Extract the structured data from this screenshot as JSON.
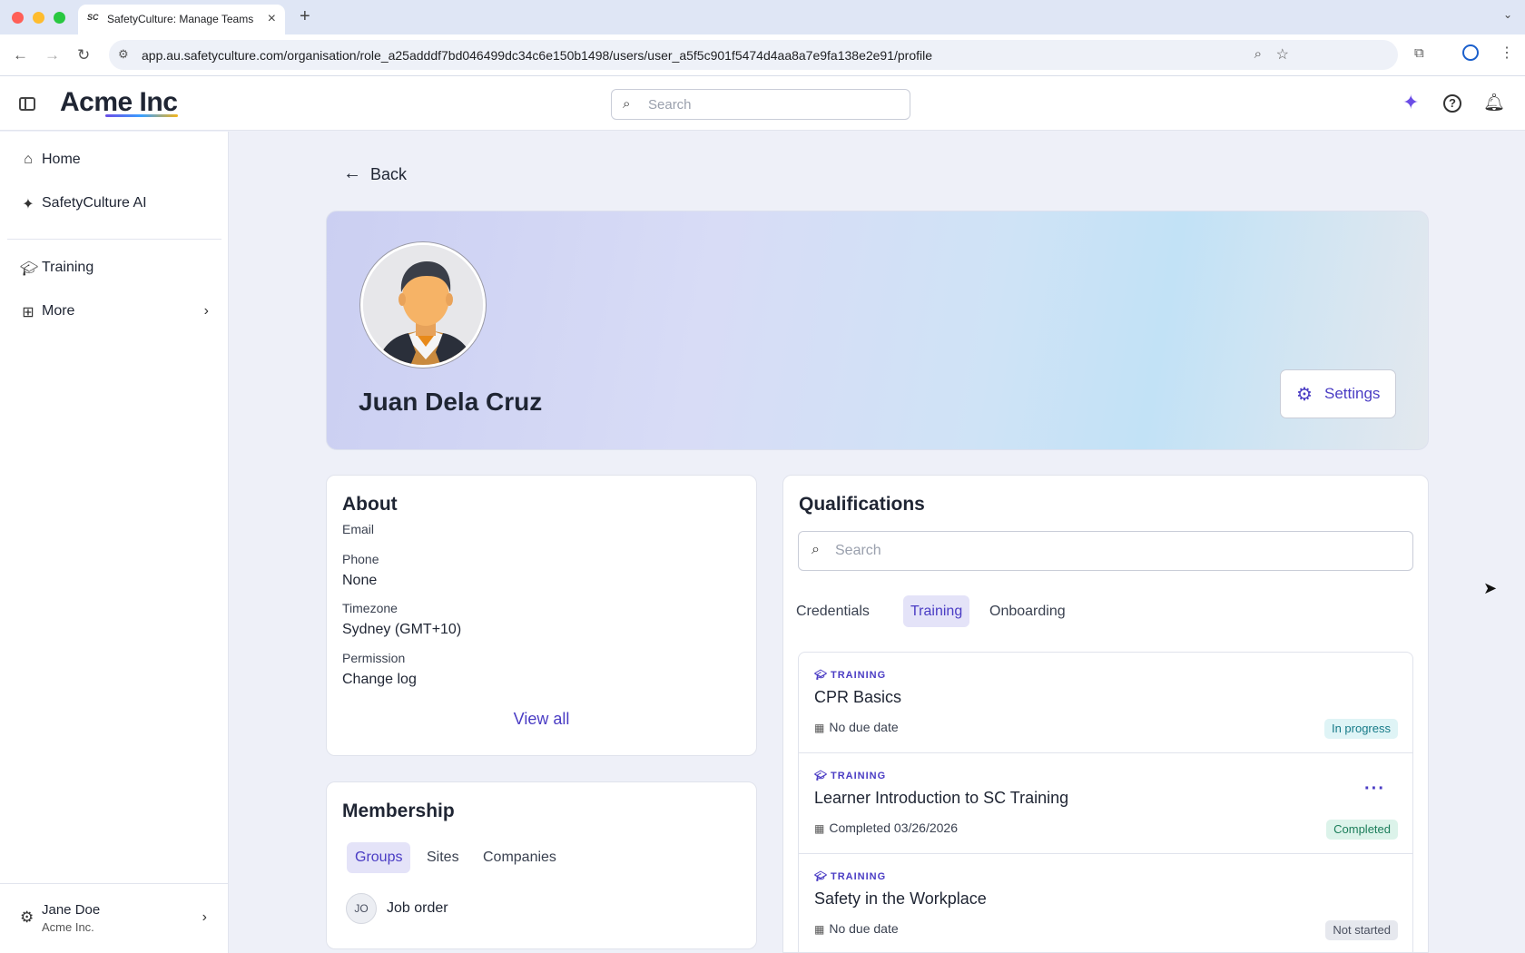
{
  "browser": {
    "tab_title": "SafetyCulture: Manage Teams",
    "favicon_text": "SC",
    "url": "app.au.safetyculture.com/organisation/role_a25adddf7bd046499dc34c6e150b1498/users/user_a5f5c901f5474d4aa8a7e9fa138e2e91/profile"
  },
  "header": {
    "logo": "Acme Inc",
    "search_placeholder": "Search",
    "icons": [
      "sidebar-toggle-icon",
      "sparkle-icon",
      "help-icon",
      "bell-icon"
    ]
  },
  "sidebar": {
    "items": [
      {
        "label": "Home",
        "icon": "home-icon"
      },
      {
        "label": "SafetyCulture AI",
        "icon": "sparkle-icon"
      },
      {
        "label": "Training",
        "icon": "graduation-cap-icon"
      },
      {
        "label": "More",
        "icon": "grid-icon"
      }
    ],
    "user": {
      "name": "Jane Doe",
      "org": "Acme Inc."
    }
  },
  "main": {
    "back_label": "Back",
    "profile": {
      "name": "Juan Dela Cruz",
      "settings_label": "Settings"
    },
    "about": {
      "title": "About",
      "fields": [
        {
          "label": "Email",
          "value": ""
        },
        {
          "label": "Phone",
          "value": "None"
        },
        {
          "label": "Timezone",
          "value": "Sydney (GMT+10)"
        },
        {
          "label": "Permission",
          "value": "Change log"
        }
      ],
      "view_all": "View all"
    },
    "membership": {
      "title": "Membership",
      "tabs": [
        {
          "label": "Groups",
          "active": true
        },
        {
          "label": "Sites",
          "active": false
        },
        {
          "label": "Companies",
          "active": false
        }
      ],
      "groups": [
        {
          "initials": "JO",
          "name": "Job order"
        }
      ]
    },
    "qualifications": {
      "title": "Qualifications",
      "search_placeholder": "Search",
      "tabs": [
        {
          "label": "Credentials",
          "active": false
        },
        {
          "label": "Training",
          "active": true
        },
        {
          "label": "Onboarding",
          "active": false
        }
      ],
      "items": [
        {
          "kind": "TRAINING",
          "title": "CPR Basics",
          "due": "No due date",
          "status": "In progress"
        },
        {
          "kind": "TRAINING",
          "title": "Learner Introduction to SC Training",
          "due": "Completed 03/26/2026",
          "status": "Completed"
        },
        {
          "kind": "TRAINING",
          "title": "Safety in the Workplace",
          "due": "No due date",
          "status": "Not started"
        }
      ]
    }
  },
  "colors": {
    "accent": "#4a3cc4",
    "brand_purple": "#6b4de6"
  }
}
